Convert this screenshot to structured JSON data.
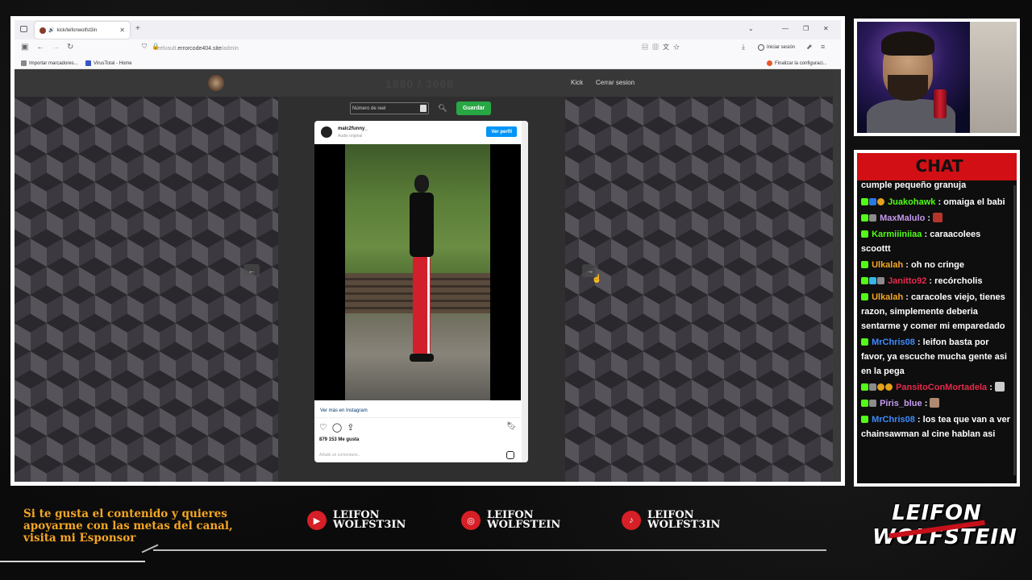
{
  "browser": {
    "tab_title": "kick/leifonwolfst3in",
    "url_prefix": "reelvault.",
    "url_host": "errorcode404.site",
    "url_path": "/admin",
    "signin_label": "Iniciar sesión",
    "bookmarks": [
      {
        "label": "Importar marcadores..."
      },
      {
        "label": "VirusTotal - Home"
      }
    ],
    "finish_config_label": "Finalizar la configuraci..."
  },
  "site": {
    "title": "1880 / 3668",
    "nav": [
      "Kick",
      "Cerrar sesion"
    ],
    "reel_input_placeholder": "Número de reel",
    "save_label": "Guardar"
  },
  "instagram": {
    "username": "malc2funny_",
    "audio": "Audio original",
    "profile_button": "Ver perfil",
    "see_more": "Ver más en Instagram",
    "likes": "879 153 Me gusta",
    "comment_placeholder": "Añade un comentario..."
  },
  "chat": {
    "title": "CHAT",
    "top_line": "cumple pequeño granuja",
    "messages": [
      {
        "user": "Juakohawk",
        "text": ": omaiga el babi",
        "color": "#53fc18"
      },
      {
        "user": "MaxMalulo",
        "text": ": ",
        "color": "#c59af0"
      },
      {
        "user": "Karmiiiniiaa",
        "text": ": caraacolees scoottt",
        "color": "#53fc18"
      },
      {
        "user": "Ulkalah",
        "text": ": oh no cringe",
        "color": "#f5a623"
      },
      {
        "user": "Janitto92",
        "text": ": recórcholis",
        "color": "#e6294b"
      },
      {
        "user": "Ulkalah",
        "text": ": caracoles viejo, tienes razon, simplemente deberia sentarme y comer mi emparedado",
        "color": "#f5a623"
      },
      {
        "user": "MrChris08",
        "text": ": leifon basta por favor, ya escuche mucha gente asi en la pega",
        "color": "#3d8bfd"
      },
      {
        "user": "PansitoConMortadela",
        "text": ": ",
        "color": "#e6294b"
      },
      {
        "user": "Piris_blue",
        "text": ": ",
        "color": "#c59af0"
      },
      {
        "user": "MrChris08",
        "text": ": los tea que van a ver chainsawman al cine hablan asi",
        "color": "#3d8bfd"
      }
    ]
  },
  "banner": {
    "sponsor_text": "Si te gusta el contenido y quieres apoyarme con las metas del canal, visita mi Esponsor",
    "socials": [
      {
        "platform": "youtube",
        "icon": "youtube-icon",
        "line1": "LEIFON",
        "line2": "WOLFST3IN"
      },
      {
        "platform": "instagram",
        "icon": "instagram-icon",
        "line1": "LEIFON",
        "line2": "WOLFSTEIN"
      },
      {
        "platform": "tiktok",
        "icon": "tiktok-icon",
        "line1": "LEIFON",
        "line2": "WOLFST3IN"
      }
    ],
    "brand_line1": "LEIFON",
    "brand_line2": "WOLFSTEIN"
  },
  "colors": {
    "accent_red": "#d10f14",
    "sponsor_orange": "#f5a623",
    "save_green": "#28a745",
    "ig_blue": "#0095f6"
  }
}
